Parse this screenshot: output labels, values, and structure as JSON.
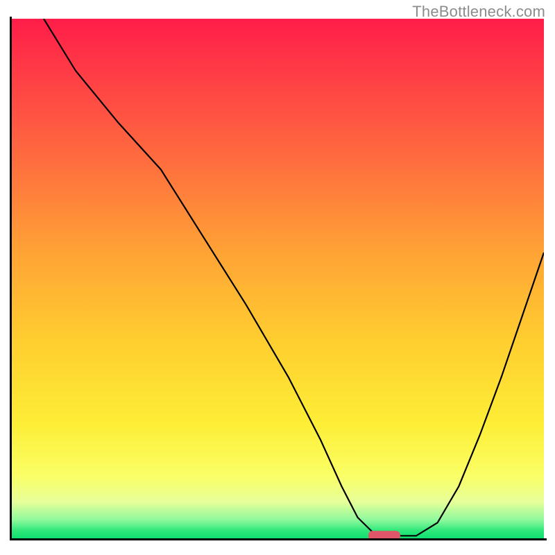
{
  "watermark": "TheBottleneck.com",
  "chart_data": {
    "type": "line",
    "title": "",
    "xlabel": "",
    "ylabel": "",
    "xlim": [
      0,
      100
    ],
    "ylim": [
      0,
      100
    ],
    "series": [
      {
        "name": "curve",
        "x": [
          6,
          12,
          20,
          28,
          36,
          44,
          52,
          58,
          62,
          65,
          68,
          72,
          76,
          80,
          84,
          88,
          92,
          96,
          100
        ],
        "values": [
          100,
          90,
          80,
          71,
          58,
          45,
          31,
          19,
          10,
          4,
          1,
          0.5,
          0.5,
          3,
          10,
          20,
          31,
          43,
          55
        ]
      }
    ],
    "marker": {
      "x": 70,
      "y": 0.5,
      "width": 6,
      "color": "#e05668"
    },
    "grid": false,
    "legend": false,
    "background_gradient": [
      "#ff1d49",
      "#ff6f3e",
      "#ffce2f",
      "#faff66",
      "#0ee072"
    ]
  }
}
